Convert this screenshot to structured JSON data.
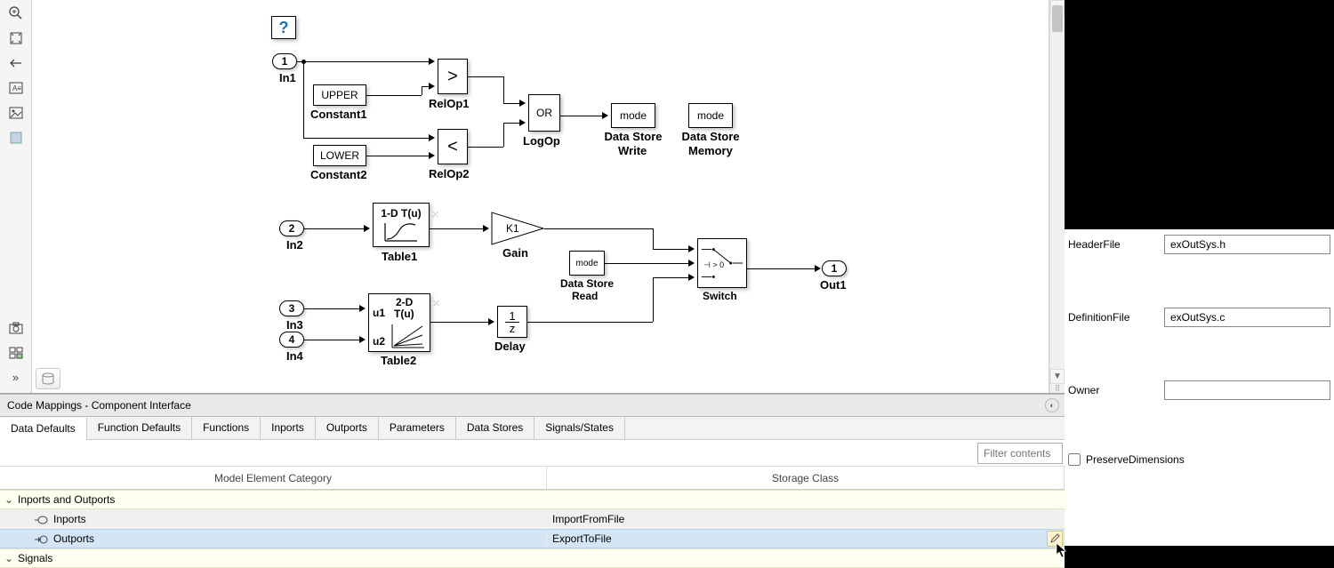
{
  "canvas": {
    "help_block": "?",
    "in1_port": "1",
    "in1_label": "In1",
    "in2_port": "2",
    "in2_label": "In2",
    "in3_port": "3",
    "in3_label": "In3",
    "in4_port": "4",
    "in4_label": "In4",
    "out1_port": "1",
    "out1_label": "Out1",
    "const_upper": "UPPER",
    "const_upper_label": "Constant1",
    "const_lower": "LOWER",
    "const_lower_label": "Constant2",
    "relop1_sym": ">",
    "relop1_label": "RelOp1",
    "relop2_sym": "<",
    "relop2_label": "RelOp2",
    "logic_text": "OR",
    "logic_label": "LogOp",
    "dsw_text": "mode",
    "dsw_label1": "Data Store",
    "dsw_label2": "Write",
    "dsm_text": "mode",
    "dsm_label1": "Data Store",
    "dsm_label2": "Memory",
    "table1_text": "1-D T(u)",
    "table1_label": "Table1",
    "gain_text": "K1",
    "gain_label": "Gain",
    "dsr_text": "mode",
    "dsr_label1": "Data Store",
    "dsr_label2": "Read",
    "switch_label": "Switch",
    "switch_text": "⊣ > 0",
    "table2_text1": "2-D",
    "table2_text2": "T(u)",
    "table2_u1": "u1",
    "table2_u2": "u2",
    "table2_label": "Table2",
    "delay_num": "1",
    "delay_den": "z",
    "delay_label": "Delay"
  },
  "panel": {
    "title": "Code Mappings - Component Interface",
    "tabs": [
      "Data Defaults",
      "Function Defaults",
      "Functions",
      "Inports",
      "Outports",
      "Parameters",
      "Data Stores",
      "Signals/States"
    ],
    "filter_placeholder": "Filter contents",
    "th1": "Model Element Category",
    "th2": "Storage Class",
    "group1": "Inports and Outports",
    "row1_name": "Inports",
    "row1_class": "ImportFromFile",
    "row2_name": "Outports",
    "row2_class": "ExportToFile",
    "group2": "Signals"
  },
  "props": {
    "header_label": "HeaderFile",
    "header_value": "exOutSys.h",
    "def_label": "DefinitionFile",
    "def_value": "exOutSys.c",
    "owner_label": "Owner",
    "owner_value": "",
    "preserve_label": "PreserveDimensions"
  }
}
